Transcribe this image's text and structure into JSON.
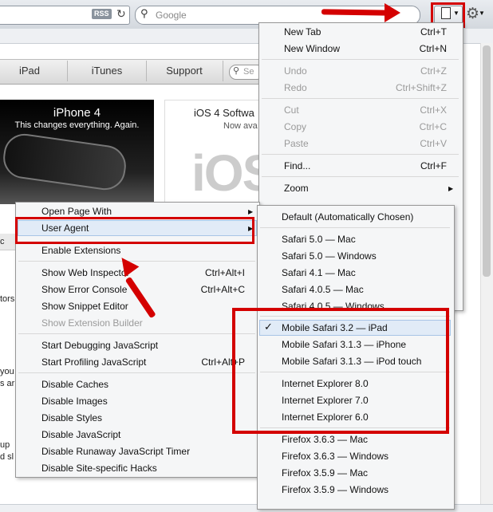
{
  "toolbar": {
    "rss_label": "RSS",
    "search_placeholder": "Google"
  },
  "site_nav": {
    "items": [
      "iPad",
      "iTunes",
      "Support"
    ],
    "search_partial": "Se"
  },
  "hero": {
    "title": "iPhone 4",
    "subtitle": "This changes everything. Again."
  },
  "ios_promo": {
    "title": "iOS 4 Softwa",
    "subtitle": "Now ava",
    "big_text": "iOS"
  },
  "left_fragments": [
    "c",
    "tors",
    "you",
    "s ar",
    "up",
    "d sl"
  ],
  "page_menu": {
    "items": [
      {
        "label": "New Tab",
        "shortcut": "Ctrl+T",
        "enabled": true
      },
      {
        "label": "New Window",
        "shortcut": "Ctrl+N",
        "enabled": true
      },
      {
        "label": "Undo",
        "shortcut": "Ctrl+Z",
        "enabled": false
      },
      {
        "label": "Redo",
        "shortcut": "Ctrl+Shift+Z",
        "enabled": false
      },
      {
        "label": "Cut",
        "shortcut": "Ctrl+X",
        "enabled": false
      },
      {
        "label": "Copy",
        "shortcut": "Ctrl+C",
        "enabled": false
      },
      {
        "label": "Paste",
        "shortcut": "Ctrl+V",
        "enabled": false
      },
      {
        "label": "Find...",
        "shortcut": "Ctrl+F",
        "enabled": true
      },
      {
        "label": "Zoom",
        "shortcut": "",
        "enabled": true,
        "submenu": true
      }
    ]
  },
  "develop_menu": {
    "items": [
      {
        "label": "Open Page With",
        "shortcut": "",
        "enabled": true,
        "submenu": true
      },
      {
        "label": "User Agent",
        "shortcut": "",
        "enabled": true,
        "submenu": true,
        "highlighted": true
      },
      {
        "label": "Enable Extensions",
        "shortcut": "",
        "enabled": true
      },
      {
        "label": "Show Web Inspector",
        "shortcut": "Ctrl+Alt+I",
        "enabled": true
      },
      {
        "label": "Show Error Console",
        "shortcut": "Ctrl+Alt+C",
        "enabled": true
      },
      {
        "label": "Show Snippet Editor",
        "shortcut": "",
        "enabled": true
      },
      {
        "label": "Show Extension Builder",
        "shortcut": "",
        "enabled": false
      },
      {
        "label": "Start Debugging JavaScript",
        "shortcut": "",
        "enabled": true
      },
      {
        "label": "Start Profiling JavaScript",
        "shortcut": "Ctrl+Alt+P",
        "enabled": true
      },
      {
        "label": "Disable Caches",
        "shortcut": "",
        "enabled": true
      },
      {
        "label": "Disable Images",
        "shortcut": "",
        "enabled": true
      },
      {
        "label": "Disable Styles",
        "shortcut": "",
        "enabled": true
      },
      {
        "label": "Disable JavaScript",
        "shortcut": "",
        "enabled": true
      },
      {
        "label": "Disable Runaway JavaScript Timer",
        "shortcut": "",
        "enabled": true
      },
      {
        "label": "Disable Site-specific Hacks",
        "shortcut": "",
        "enabled": true
      }
    ]
  },
  "user_agent_menu": {
    "items": [
      {
        "label": "Default (Automatically Chosen)",
        "checked": false
      },
      {
        "label": "Safari 5.0 — Mac",
        "checked": false
      },
      {
        "label": "Safari 5.0 — Windows",
        "checked": false
      },
      {
        "label": "Safari 4.1 — Mac",
        "checked": false
      },
      {
        "label": "Safari 4.0.5 — Mac",
        "checked": false
      },
      {
        "label": "Safari 4.0.5 — Windows",
        "checked": false
      },
      {
        "label": "Mobile Safari 3.2 — iPad",
        "checked": true
      },
      {
        "label": "Mobile Safari 3.1.3 — iPhone",
        "checked": false
      },
      {
        "label": "Mobile Safari 3.1.3 — iPod touch",
        "checked": false
      },
      {
        "label": "Internet Explorer 8.0",
        "checked": false
      },
      {
        "label": "Internet Explorer 7.0",
        "checked": false
      },
      {
        "label": "Internet Explorer 6.0",
        "checked": false
      },
      {
        "label": "Firefox 3.6.3 — Mac",
        "checked": false
      },
      {
        "label": "Firefox 3.6.3 — Windows",
        "checked": false
      },
      {
        "label": "Firefox 3.5.9 — Mac",
        "checked": false
      },
      {
        "label": "Firefox 3.5.9 — Windows",
        "checked": false
      }
    ]
  },
  "colors": {
    "annotation_red": "#d40000",
    "menu_bg": "#f5f6f7",
    "highlight_bg": "#e1ebf7"
  }
}
